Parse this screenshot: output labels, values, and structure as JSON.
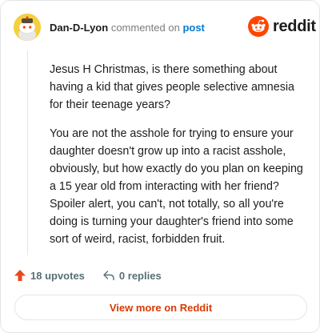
{
  "header": {
    "author": "Dan-D-Lyon",
    "action_text": "commented on",
    "post_link": "post",
    "brand": "reddit"
  },
  "comment": {
    "paragraphs": [
      "Jesus H Christmas, is there something about having a kid that gives people selective amnesia for their teenage years?",
      "You are not the asshole for trying to ensure your daughter doesn't grow up into a racist asshole, obviously, but how exactly do you plan on keeping a 15 year old from interacting with her friend? Spoiler alert, you can't, not totally, so all you're doing is turning your daughter's friend into some sort of weird, racist, forbidden fruit."
    ]
  },
  "actions": {
    "upvotes": "18 upvotes",
    "replies": "0 replies"
  },
  "footer": {
    "view_more": "View more on Reddit"
  },
  "colors": {
    "brand_orange": "#ff4500",
    "link_blue": "#0079d3",
    "avatar_yellow": "#f4d03f",
    "upvote_arrow": "#e8491d",
    "view_more_text": "#d93a00"
  },
  "icons": [
    "avatar-snoo-icon",
    "reddit-logo-icon",
    "upvote-arrow-icon",
    "reply-icon"
  ]
}
